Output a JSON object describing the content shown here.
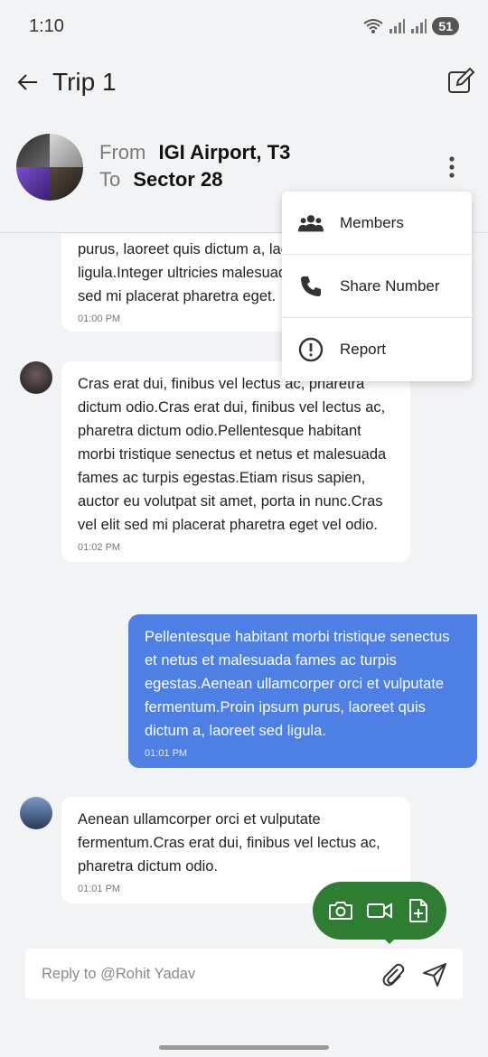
{
  "status_bar": {
    "time": "1:10",
    "battery": "51"
  },
  "app_bar": {
    "title": "Trip 1"
  },
  "trip": {
    "from_label": "From",
    "from_value": "IGI Airport, T3",
    "to_label": "To",
    "to_value": "Sector 28"
  },
  "menu": {
    "items": [
      {
        "label": "Members",
        "icon": "group-icon"
      },
      {
        "label": "Share Number",
        "icon": "phone-icon"
      },
      {
        "label": "Report",
        "icon": "alert-icon"
      }
    ]
  },
  "messages": [
    {
      "direction": "in",
      "text": "purus, laoreet quis dictum a, laoreet sed ligula.Integer ultricies malesuada tortor, vel elit sed mi placerat pharetra eget.",
      "time": "01:00 PM"
    },
    {
      "direction": "in",
      "text": "Cras erat dui, finibus vel lectus ac, pharetra dictum odio.Cras erat dui, finibus vel lectus ac, pharetra dictum odio.Pellentesque habitant morbi tristique senectus et netus et malesuada fames ac turpis egestas.Etiam risus sapien, auctor eu volutpat sit amet, porta in nunc.Cras vel elit sed mi placerat pharetra eget vel odio.",
      "time": "01:02 PM"
    },
    {
      "direction": "out",
      "text": "Pellentesque habitant morbi tristique senectus et netus et malesuada fames ac turpis egestas.Aenean ullamcorper orci et vulputate fermentum.Proin ipsum purus, laoreet quis dictum a, laoreet sed ligula.",
      "time": "01:01 PM"
    },
    {
      "direction": "in",
      "text": "Aenean ullamcorper orci et vulputate fermentum.Cras erat dui, finibus vel lectus ac, pharetra dictum odio.",
      "time": "01:01 PM"
    }
  ],
  "composer": {
    "placeholder": "Reply to @Rohit Yadav"
  },
  "colors": {
    "accent_blue": "#4d7fe4",
    "media_green": "#2e7d32",
    "background": "#f2f3f5"
  }
}
